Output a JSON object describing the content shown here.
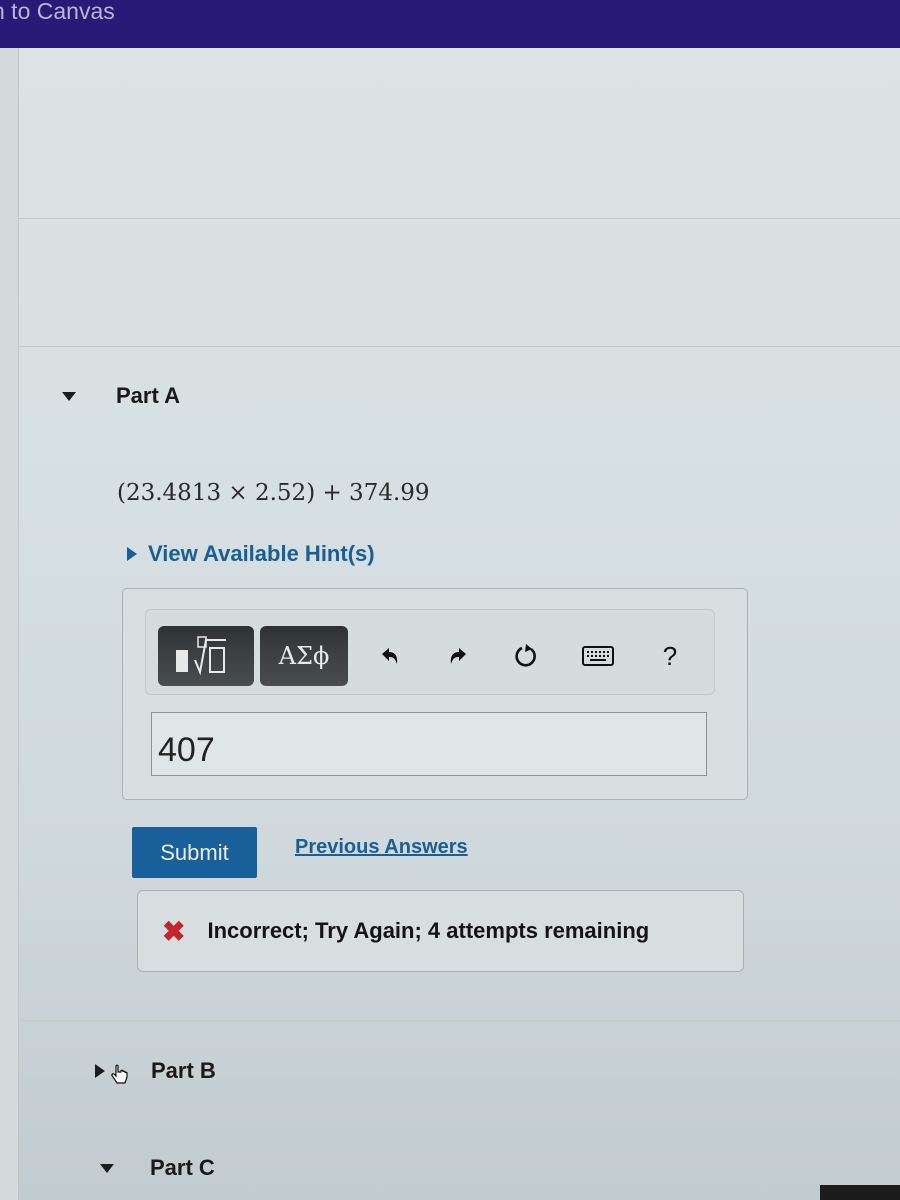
{
  "topbar": {
    "back_link": "n to Canvas",
    "color": "#2a1a78"
  },
  "parts": [
    {
      "label": "Part A",
      "state": "expanded"
    },
    {
      "label": "Part B",
      "state": "collapsed"
    },
    {
      "label": "Part C",
      "state": "expanded"
    }
  ],
  "part_a": {
    "question": "(23.4813 × 2.52) + 374.99",
    "hint_link": "View Available Hint(s)",
    "toolbar": {
      "templates_icon": "fraction-sqrt-icon",
      "greek_label": "ΑΣϕ",
      "undo_icon": "undo-icon",
      "redo_icon": "redo-icon",
      "reset_icon": "reset-icon",
      "keyboard_icon": "keyboard-icon",
      "help_label": "?"
    },
    "answer_value": "407",
    "submit_label": "Submit",
    "previous_answers_label": "Previous Answers",
    "feedback": {
      "icon": "✖",
      "message": "Incorrect; Try Again; 4 attempts remaining",
      "icon_color": "#c0262a"
    }
  },
  "colors": {
    "link": "#1a5f94",
    "submit_bg": "#19609a"
  }
}
